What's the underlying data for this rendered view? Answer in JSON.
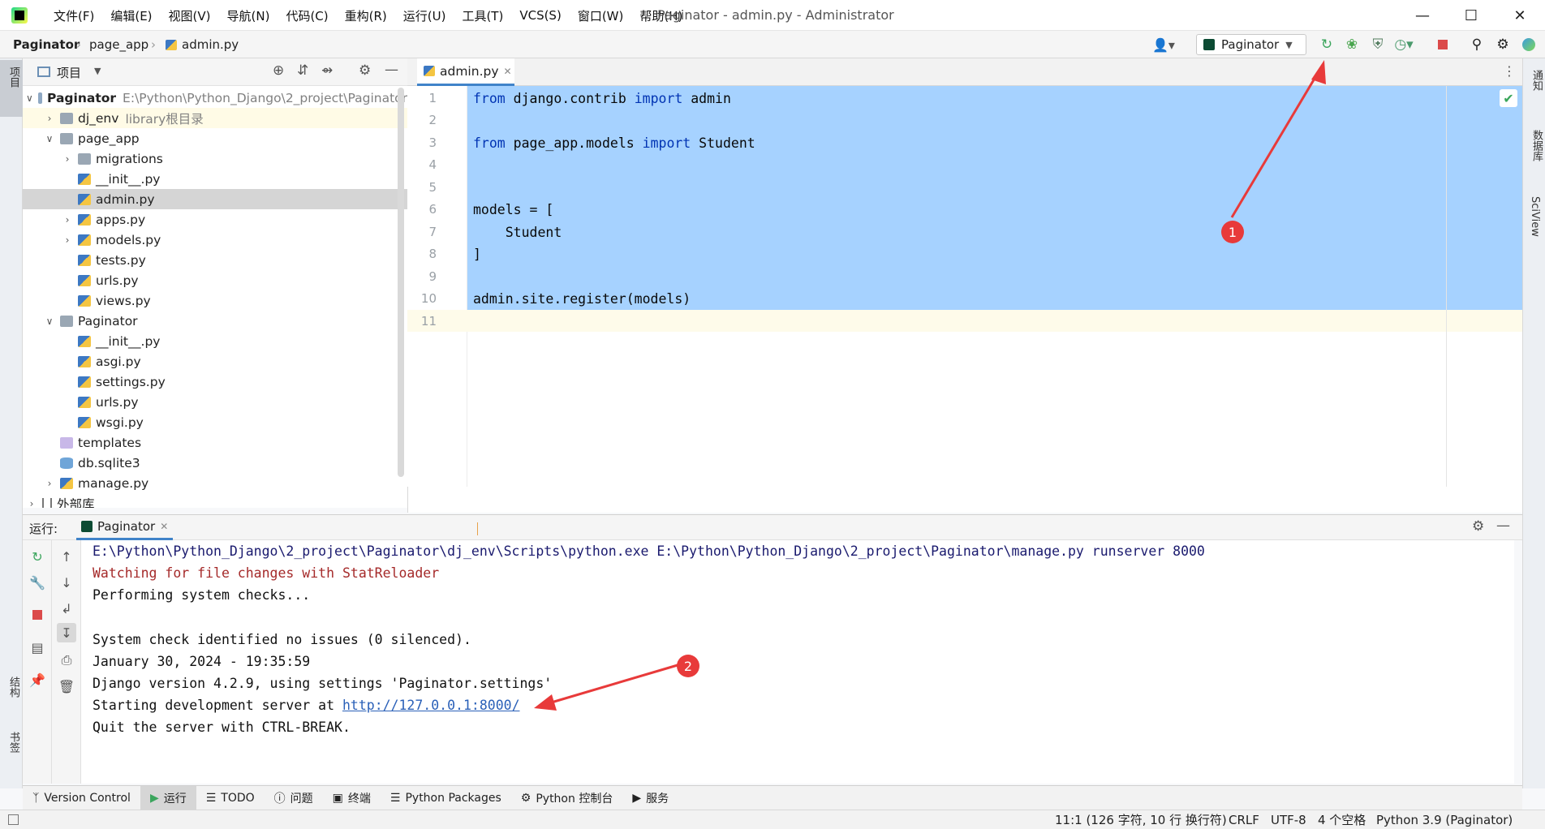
{
  "menu": [
    "文件(F)",
    "编辑(E)",
    "视图(V)",
    "导航(N)",
    "代码(C)",
    "重构(R)",
    "运行(U)",
    "工具(T)",
    "VCS(S)",
    "窗口(W)",
    "帮助(H)"
  ],
  "window_title": "Paginator - admin.py - Administrator",
  "breadcrumb": {
    "project": "Paginator",
    "folder": "page_app",
    "file": "admin.py"
  },
  "run_config": "Paginator",
  "left_strip": {
    "project": "项目",
    "structure": "结构",
    "bookmarks": "书签"
  },
  "right_strip": {
    "notifications": "通知",
    "database": "数据库",
    "sciview": "SciView"
  },
  "project_panel": {
    "title": "项目"
  },
  "tree": [
    {
      "label": "Paginator",
      "hint": "E:\\Python\\Python_Django\\2_project\\Paginator",
      "bold": true
    },
    {
      "label": "dj_env",
      "hint": "library根目录"
    },
    {
      "label": "page_app"
    },
    {
      "label": "migrations"
    },
    {
      "label": "__init__.py"
    },
    {
      "label": "admin.py"
    },
    {
      "label": "apps.py"
    },
    {
      "label": "models.py"
    },
    {
      "label": "tests.py"
    },
    {
      "label": "urls.py"
    },
    {
      "label": "views.py"
    },
    {
      "label": "Paginator"
    },
    {
      "label": "__init__.py"
    },
    {
      "label": "asgi.py"
    },
    {
      "label": "settings.py"
    },
    {
      "label": "urls.py"
    },
    {
      "label": "wsgi.py"
    },
    {
      "label": "templates"
    },
    {
      "label": "db.sqlite3"
    },
    {
      "label": "manage.py"
    },
    {
      "label": "外部库"
    }
  ],
  "editor_tab": "admin.py",
  "line_numbers": [
    "1",
    "2",
    "3",
    "4",
    "5",
    "6",
    "7",
    "8",
    "9",
    "10",
    "11"
  ],
  "code": {
    "l1": {
      "kw1": "from",
      "t1": " django.contrib ",
      "kw2": "import",
      "t2": " admin"
    },
    "l3": {
      "kw1": "from",
      "t1": " page_app.models ",
      "kw2": "import",
      "t2": " Student"
    },
    "l6": "models = [",
    "l7": "    Student",
    "l8": "]",
    "l10": "admin.site.register(models)"
  },
  "run_panel": {
    "label": "运行:",
    "tab": "Paginator"
  },
  "console": [
    "E:\\Python\\Python_Django\\2_project\\Paginator\\dj_env\\Scripts\\python.exe E:\\Python\\Python_Django\\2_project\\Paginator\\manage.py runserver 8000",
    "Watching for file changes with StatReloader",
    "Performing system checks...",
    "System check identified no issues (0 silenced).",
    "January 30, 2024 - 19:35:59",
    "Django version 4.2.9, using settings 'Paginator.settings'",
    "Starting development server at ",
    "http://127.0.0.1:8000/",
    "Quit the server with CTRL-BREAK."
  ],
  "bottom_tabs": [
    "Version Control",
    "运行",
    "TODO",
    "问题",
    "终端",
    "Python Packages",
    "Python 控制台",
    "服务"
  ],
  "status": {
    "position": "11:1 (126 字符, 10 行 换行符)",
    "line_sep": "CRLF",
    "encoding": "UTF-8",
    "indent": "4 个空格",
    "interpreter": "Python 3.9 (Paginator)"
  },
  "annotations": {
    "badge1": "1",
    "badge2": "2"
  },
  "colors": {
    "selection": "#a6d2ff",
    "keyword": "#0033b3",
    "annotation": "#e83a3a",
    "link": "#2a60b8"
  }
}
